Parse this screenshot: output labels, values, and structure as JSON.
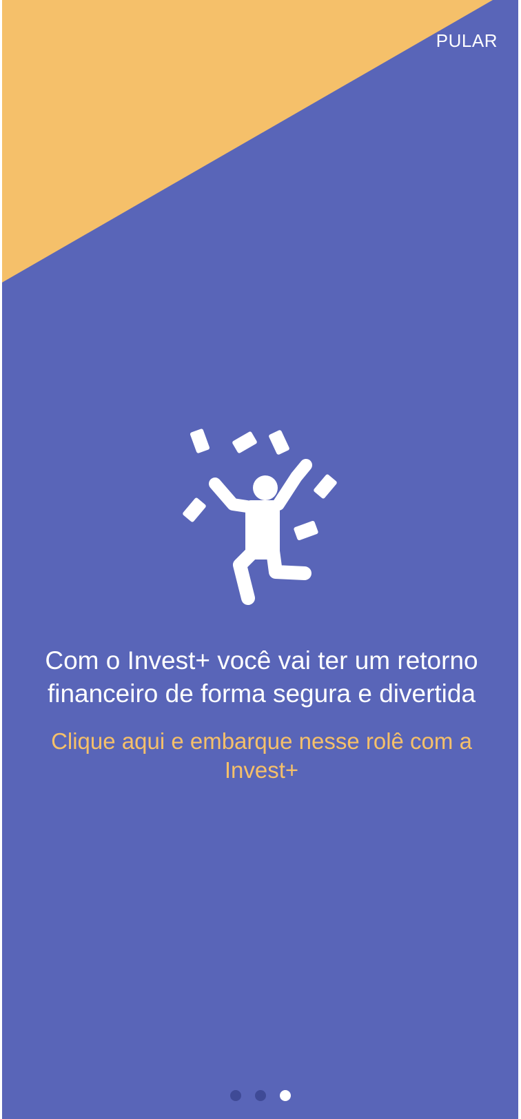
{
  "onboarding": {
    "skip_label": "PULAR",
    "headline": "Com o Invest+ você vai ter um retorno financeiro de forma segura e divertida",
    "cta": "Clique aqui e embarque nesse rolê com a Invest+",
    "illustration_icon": "celebrating-person-with-money-icon",
    "pagination": {
      "total": 3,
      "current": 3
    }
  },
  "colors": {
    "background": "#5965b8",
    "accent": "#f5c06a",
    "text": "#ffffff",
    "dot_inactive": "#3f4a96",
    "dot_active": "#ffffff"
  }
}
